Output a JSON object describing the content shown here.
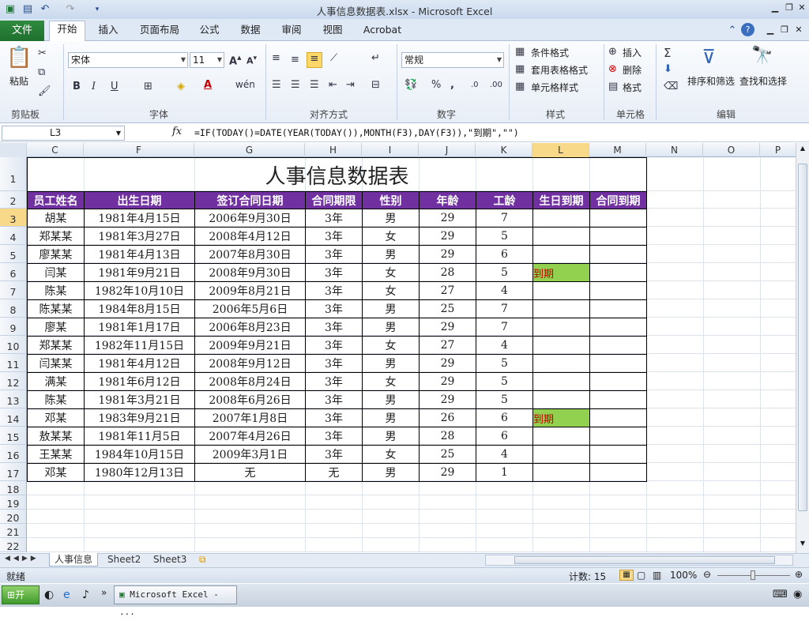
{
  "window": {
    "title": "人事信息数据表.xlsx  -  Microsoft Excel"
  },
  "ribbon_tabs": [
    "开始",
    "插入",
    "页面布局",
    "公式",
    "数据",
    "审阅",
    "视图",
    "Acrobat"
  ],
  "file_tab": "文件",
  "ribbon": {
    "clipboard": {
      "label": "剪贴板",
      "paste": "粘贴"
    },
    "font": {
      "label": "字体",
      "name": "宋体",
      "size": "11"
    },
    "alignment": {
      "label": "对齐方式"
    },
    "number": {
      "label": "数字",
      "format": "常规"
    },
    "styles": {
      "label": "样式",
      "conditional": "条件格式",
      "table_style": "套用表格格式",
      "cell_style": "单元格样式"
    },
    "cells": {
      "label": "单元格",
      "insert": "插入",
      "delete": "删除",
      "format": "格式"
    },
    "editing": {
      "label": "编辑",
      "sort": "排序和筛选",
      "find": "查找和选择"
    }
  },
  "formula_bar": {
    "name_box": "L3",
    "fx": "fx",
    "formula": "=IF(TODAY()=DATE(YEAR(TODAY()),MONTH(F3),DAY(F3)),\"到期\",\"\")"
  },
  "columns": [
    "C",
    "F",
    "G",
    "H",
    "I",
    "J",
    "K",
    "L",
    "M",
    "N",
    "O",
    "P"
  ],
  "rows": [
    "1",
    "2",
    "3",
    "4",
    "5",
    "6",
    "7",
    "8",
    "9",
    "10",
    "11",
    "12",
    "13",
    "14",
    "15",
    "16",
    "17",
    "18",
    "19",
    "20",
    "21",
    "22"
  ],
  "sheet": {
    "title": "人事信息数据表",
    "headers": [
      "员工姓名",
      "出生日期",
      "签订合同日期",
      "合同期限",
      "性别",
      "年龄",
      "工龄",
      "生日到期",
      "合同到期"
    ],
    "data": [
      [
        "胡某",
        "1981年4月15日",
        "2006年9月30日",
        "3年",
        "男",
        "29",
        "7",
        "",
        ""
      ],
      [
        "郑某某",
        "1981年3月27日",
        "2008年4月12日",
        "3年",
        "女",
        "29",
        "5",
        "",
        ""
      ],
      [
        "廖某某",
        "1981年4月13日",
        "2007年8月30日",
        "3年",
        "男",
        "29",
        "6",
        "",
        ""
      ],
      [
        "闫某",
        "1981年9月21日",
        "2008年9月30日",
        "3年",
        "女",
        "28",
        "5",
        "到期",
        ""
      ],
      [
        "陈某",
        "1982年10月10日",
        "2009年8月21日",
        "3年",
        "女",
        "27",
        "4",
        "",
        ""
      ],
      [
        "陈某某",
        "1984年8月15日",
        "2006年5月6日",
        "3年",
        "男",
        "25",
        "7",
        "",
        ""
      ],
      [
        "廖某",
        "1981年1月17日",
        "2006年8月23日",
        "3年",
        "男",
        "29",
        "7",
        "",
        ""
      ],
      [
        "郑某某",
        "1982年11月15日",
        "2009年9月21日",
        "3年",
        "女",
        "27",
        "4",
        "",
        ""
      ],
      [
        "闫某某",
        "1981年4月12日",
        "2008年9月12日",
        "3年",
        "男",
        "29",
        "5",
        "",
        ""
      ],
      [
        "满某",
        "1981年6月12日",
        "2008年8月24日",
        "3年",
        "女",
        "29",
        "5",
        "",
        ""
      ],
      [
        "陈某",
        "1981年3月21日",
        "2008年6月26日",
        "3年",
        "男",
        "29",
        "5",
        "",
        ""
      ],
      [
        "邓某",
        "1983年9月21日",
        "2007年1月8日",
        "3年",
        "男",
        "26",
        "6",
        "到期",
        ""
      ],
      [
        "敖某某",
        "1981年11月5日",
        "2007年4月26日",
        "3年",
        "男",
        "28",
        "6",
        "",
        ""
      ],
      [
        "王某某",
        "1984年10月15日",
        "2009年3月1日",
        "3年",
        "女",
        "25",
        "4",
        "",
        ""
      ],
      [
        "邓某",
        "1980年12月13日",
        "无",
        "无",
        "男",
        "29",
        "1",
        "",
        ""
      ]
    ]
  },
  "sheet_tabs": [
    "人事信息",
    "Sheet2",
    "Sheet3"
  ],
  "status": {
    "ready": "就绪",
    "count": "计数: 15",
    "zoom": "100%"
  },
  "taskbar": {
    "start": "开始",
    "app": "Microsoft Excel - ..."
  },
  "colors": {
    "header_bg": "#7030a0",
    "due_bg": "#92d050",
    "due_text": "#c00000",
    "file_tab": "#2f8b3f"
  }
}
